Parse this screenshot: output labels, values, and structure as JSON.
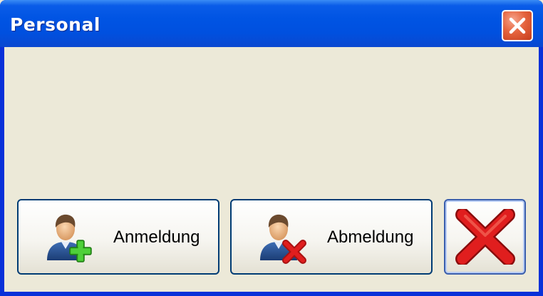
{
  "window": {
    "title": "Personal"
  },
  "buttons": {
    "login_label": "Anmeldung",
    "logout_label": "Abmeldung"
  },
  "icons": {
    "close_window": "close-icon",
    "login": "user-add-icon",
    "logout": "user-remove-icon",
    "cancel": "cancel-x-icon"
  },
  "colors": {
    "titlebar": "#0054e3",
    "client_background": "#ece9d8",
    "close_button": "#e5643e",
    "button_border": "#003c74",
    "cancel_red": "#e01e1e",
    "plus_green": "#3cb828"
  }
}
